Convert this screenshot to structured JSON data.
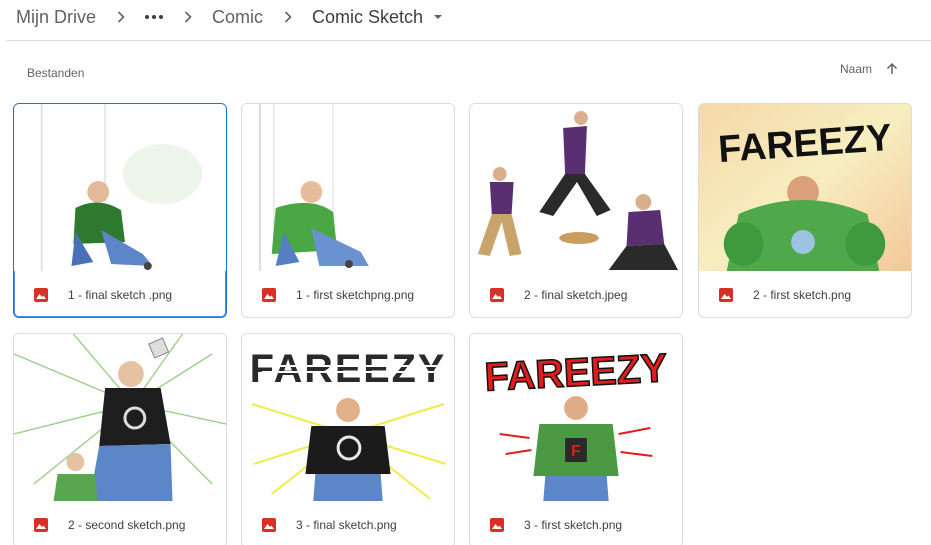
{
  "breadcrumb": {
    "root": "Mijn Drive",
    "folder": "Comic",
    "current": "Comic Sketch"
  },
  "section": {
    "label": "Bestanden"
  },
  "sort": {
    "label": "Naam"
  },
  "files": [
    {
      "name": "1 - final sketch .png",
      "type": "image-icon",
      "selected": true
    },
    {
      "name": "1 - first sketchpng.png",
      "type": "image-icon",
      "selected": false
    },
    {
      "name": "2 - final sketch.jpeg",
      "type": "image-icon",
      "selected": false
    },
    {
      "name": "2 - first sketch.png",
      "type": "image-icon",
      "selected": false
    },
    {
      "name": "2 - second sketch.png",
      "type": "image-icon",
      "selected": false
    },
    {
      "name": "3 - final sketch.png",
      "type": "image-icon",
      "selected": false
    },
    {
      "name": "3 - first sketch.png",
      "type": "image-icon",
      "selected": false
    }
  ],
  "thumbnails": {
    "title_text": "FAREEZY"
  },
  "colors": {
    "selected_border": "#1a73e8",
    "file_icon": "#d93025",
    "divider": "#dadce0"
  }
}
